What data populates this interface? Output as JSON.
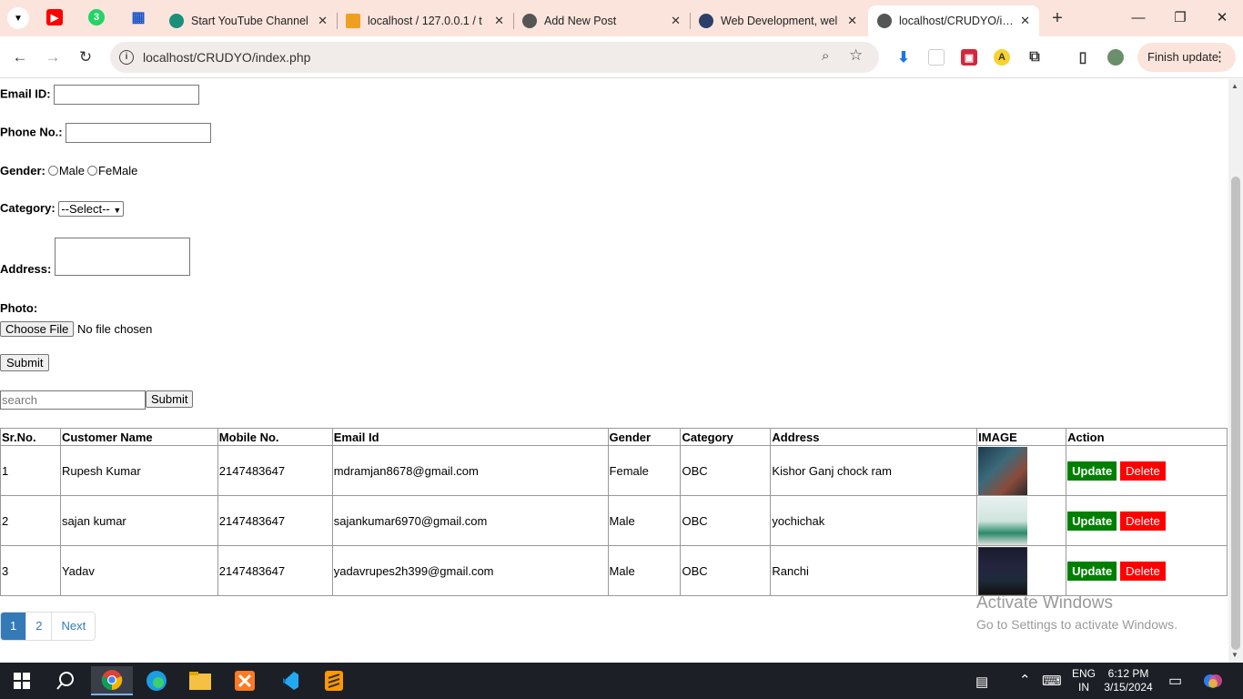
{
  "browser": {
    "tabs": [
      {
        "label": "Start YouTube Channel",
        "fav_color": "#1a8f7a"
      },
      {
        "label": "localhost / 127.0.0.1 / t",
        "fav_color": "#f0a020"
      },
      {
        "label": "Add New Post",
        "fav_color": "#555555"
      },
      {
        "label": "Web Development, wel",
        "fav_color": "#2c3e6a"
      },
      {
        "label": "localhost/CRUDYO/inde",
        "fav_color": "#555555"
      }
    ],
    "url": "localhost/CRUDYO/index.php",
    "finish_update": "Finish update"
  },
  "form": {
    "email_label": "Email ID:",
    "phone_label": "Phone No.:",
    "gender_label": "Gender:",
    "gender_male": "Male",
    "gender_female": "FeMale",
    "category_label": "Category:",
    "category_selected": "--Select--",
    "address_label": "Address:",
    "photo_label": "Photo:",
    "choose_file": "Choose File",
    "no_file": "No file chosen",
    "submit": "Submit"
  },
  "search": {
    "placeholder": "search",
    "submit": "Submit"
  },
  "table": {
    "headers": [
      "Sr.No.",
      "Customer Name",
      "Mobile No.",
      "Email Id",
      "Gender",
      "Category",
      "Address",
      "IMAGE",
      "Action"
    ],
    "rows": [
      {
        "sr": "1",
        "name": "Rupesh Kumar",
        "mobile": "2147483647",
        "email": "mdramjan8678@gmail.com",
        "gender": "Female",
        "category": "OBC",
        "address": "Kishor Ganj chock ram"
      },
      {
        "sr": "2",
        "name": "sajan kumar",
        "mobile": "2147483647",
        "email": "sajankumar6970@gmail.com",
        "gender": "Male",
        "category": "OBC",
        "address": "yochichak"
      },
      {
        "sr": "3",
        "name": "Yadav",
        "mobile": "2147483647",
        "email": "yadavrupes2h399@gmail.com",
        "gender": "Male",
        "category": "OBC",
        "address": "Ranchi"
      }
    ],
    "update_label": "Update",
    "delete_label": "Delete"
  },
  "pagination": {
    "pages": [
      "1",
      "2"
    ],
    "next": "Next"
  },
  "watermark": {
    "line1": "Activate Windows",
    "line2": "Go to Settings to activate Windows."
  },
  "taskbar": {
    "lang1": "ENG",
    "lang2": "IN",
    "time": "6:12 PM",
    "date": "3/15/2024"
  },
  "colors": {
    "update_bg": "#008000",
    "delete_bg": "#ff0000",
    "pager_active": "#337ab7"
  }
}
